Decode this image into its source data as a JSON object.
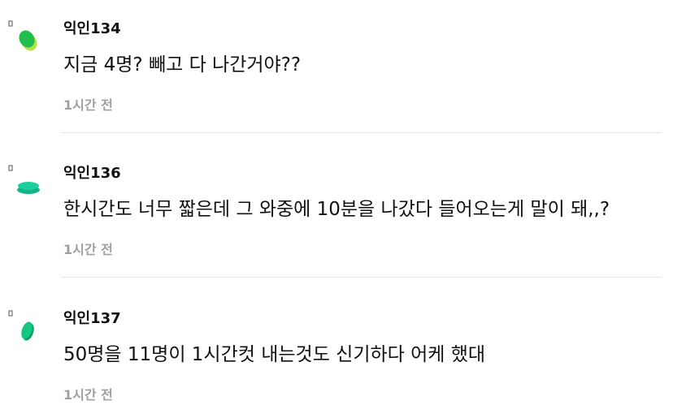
{
  "comments": [
    {
      "author": "익인134",
      "text": "지금 4명? 빼고 다 나간거야??",
      "time": "1시간 전",
      "avatar_icon": "green-blob-avatar-icon",
      "avatar_colors": [
        "#1fbf4d",
        "#b8e04a"
      ]
    },
    {
      "author": "익인136",
      "text": "한시간도 너무 짧은데 그 와중에 10분을 나갔다 들어오는게 말이 돼,,?",
      "time": "1시간 전",
      "avatar_icon": "teal-disc-avatar-icon",
      "avatar_colors": [
        "#1ccf9c",
        "#12b389"
      ]
    },
    {
      "author": "익인137",
      "text": "50명을 11명이 1시간컷 내는것도 신기하다 어케 했대",
      "time": "1시간 전",
      "avatar_icon": "green-leaf-avatar-icon",
      "avatar_colors": [
        "#14c77f",
        "#0e9e5f"
      ]
    }
  ]
}
